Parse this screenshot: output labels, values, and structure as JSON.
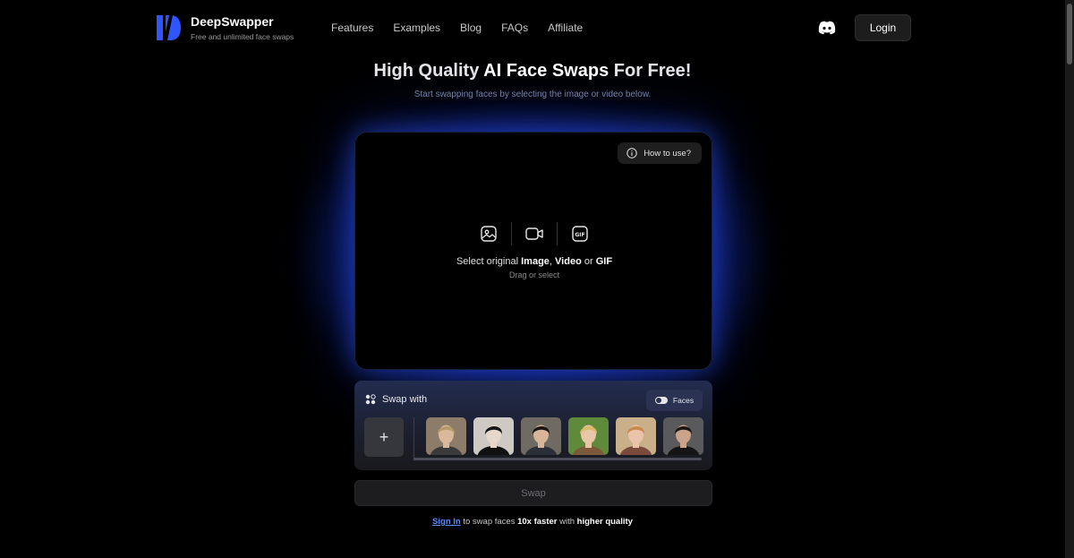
{
  "header": {
    "brand_name": "DeepSwapper",
    "brand_tagline": "Free and unlimited face swaps",
    "nav": [
      "Features",
      "Examples",
      "Blog",
      "FAQs",
      "Affiliate"
    ],
    "discord_icon": "discord-icon",
    "login_label": "Login"
  },
  "hero": {
    "title_pre": "High Quality ",
    "title_bold": "AI Face Swaps",
    "title_post": " For Free!",
    "subtitle": "Start swapping faces by selecting the image or video below."
  },
  "upload": {
    "how_to_label": "How to use?",
    "select_pre": "Select original ",
    "select_image": "Image",
    "select_comma": ", ",
    "select_video": "Video",
    "select_or": " or ",
    "select_gif": "GIF",
    "drag_text": "Drag or select",
    "icons": [
      "image-icon",
      "video-camera-icon",
      "gif-icon"
    ]
  },
  "swap_panel": {
    "label": "Swap with",
    "faces_toggle_label": "Faces",
    "add_label": "+",
    "faces": [
      {
        "bg": "#8e7c6a",
        "skin": "#d9b99a",
        "hair": "#b59a6a",
        "shirt": "#3a3a3a"
      },
      {
        "bg": "#cfc9c4",
        "skin": "#e6d6cc",
        "hair": "#141414",
        "shirt": "#111111"
      },
      {
        "bg": "#6f6a62",
        "skin": "#d7b49a",
        "hair": "#1c1612",
        "shirt": "#2b2f38"
      },
      {
        "bg": "#5f8a3a",
        "skin": "#e8c6a8",
        "hair": "#d9b96a",
        "shirt": "#7a5a3a"
      },
      {
        "bg": "#c9b08a",
        "skin": "#eac3aa",
        "hair": "#c98a4a",
        "shirt": "#7a4a3a"
      },
      {
        "bg": "#5a5a5c",
        "skin": "#c9a48a",
        "hair": "#1a1614",
        "shirt": "#151515"
      }
    ]
  },
  "swap_button_label": "Swap",
  "signin": {
    "link": "Sign In",
    "mid": " to swap faces ",
    "fast": "10x faster",
    "with": " with ",
    "quality": "higher quality"
  },
  "colors": {
    "accent_blue": "#2a4fff",
    "link_blue": "#5b8cff",
    "background": "#000000"
  }
}
